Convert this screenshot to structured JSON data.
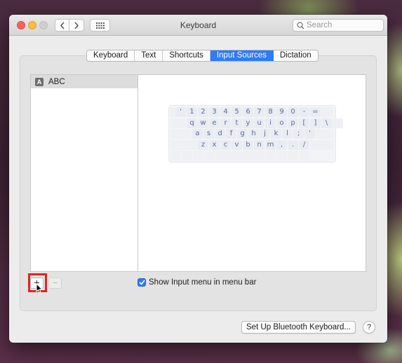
{
  "window": {
    "title": "Keyboard",
    "search_placeholder": "Search"
  },
  "tabs": [
    {
      "label": "Keyboard",
      "active": false
    },
    {
      "label": "Text",
      "active": false
    },
    {
      "label": "Shortcuts",
      "active": false
    },
    {
      "label": "Input Sources",
      "active": true
    },
    {
      "label": "Dictation",
      "active": false
    }
  ],
  "sources": [
    {
      "badge": "A",
      "name": "ABC",
      "selected": true
    }
  ],
  "keyboard_rows": [
    [
      "'",
      "1",
      "2",
      "3",
      "4",
      "5",
      "6",
      "7",
      "8",
      "9",
      "0",
      "-",
      "="
    ],
    [
      "q",
      "w",
      "e",
      "r",
      "t",
      "y",
      "u",
      "i",
      "o",
      "p",
      "[",
      "]",
      "\\"
    ],
    [
      "a",
      "s",
      "d",
      "f",
      "g",
      "h",
      "j",
      "k",
      "l",
      ";",
      "'"
    ],
    [
      "z",
      "x",
      "c",
      "v",
      "b",
      "n",
      "m",
      ",",
      ".",
      "/"
    ]
  ],
  "controls": {
    "add_label": "+",
    "remove_label": "−",
    "show_input_menu_label": "Show Input menu in menu bar",
    "show_input_menu_checked": true,
    "bluetooth_button": "Set Up Bluetooth Keyboard...",
    "help_label": "?"
  },
  "colors": {
    "accent": "#2f7bf5",
    "highlight_box": "#e0241f",
    "key_text": "#5c6c8e"
  }
}
